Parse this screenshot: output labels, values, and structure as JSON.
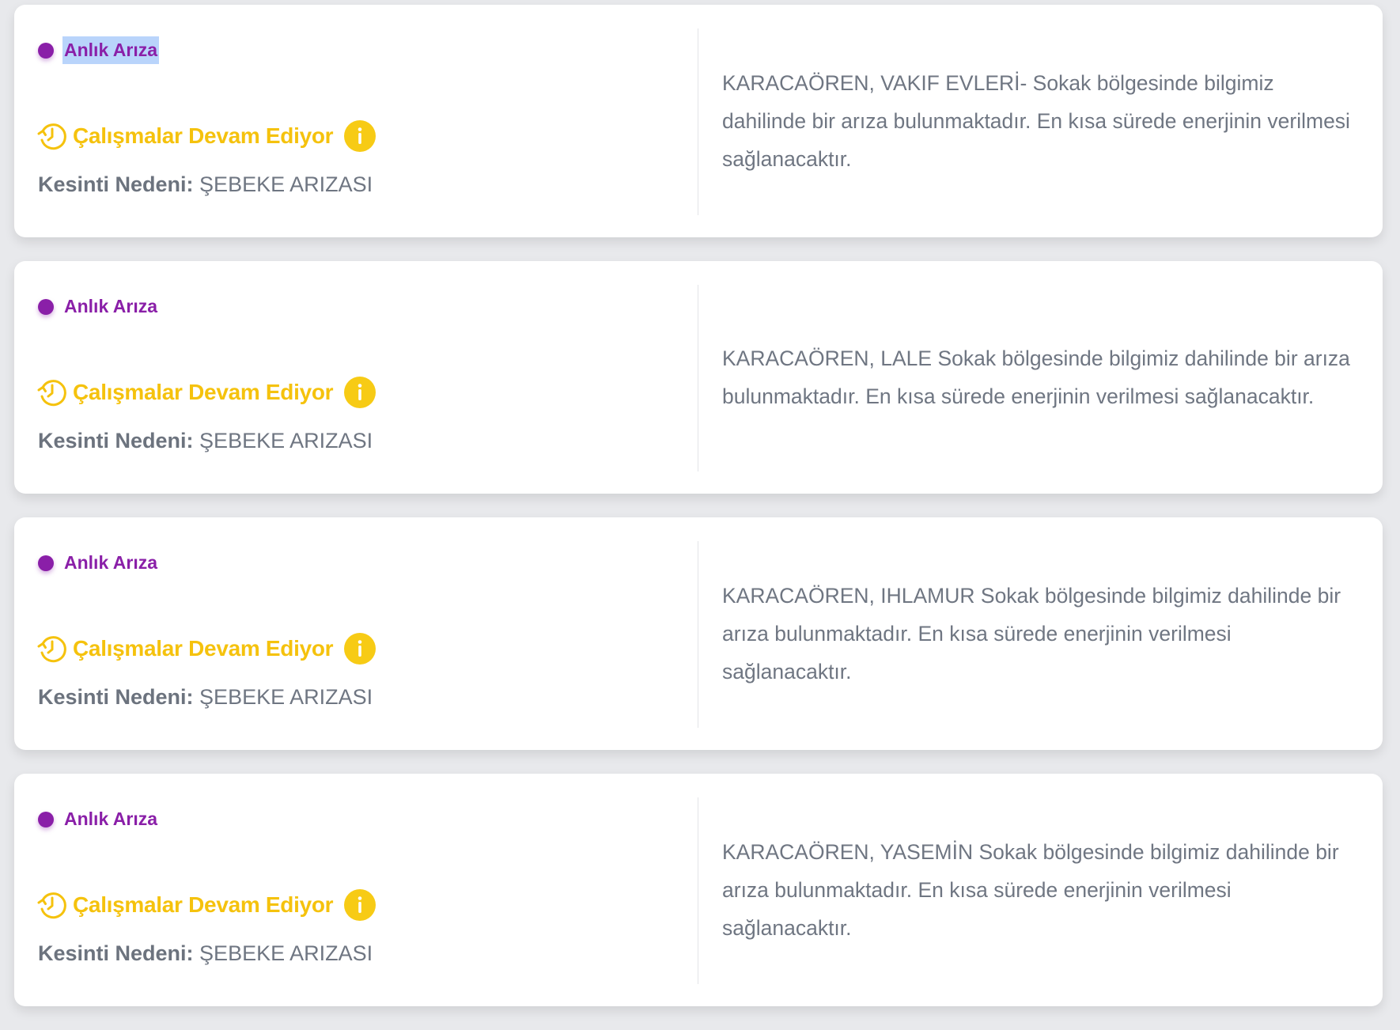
{
  "colors": {
    "type_accent": "#8a1fa8",
    "status_accent": "#f5c20d",
    "text": "#6f7682",
    "background": "#e8e9ec"
  },
  "icons": {
    "status": "clock-progress-icon",
    "info": "info-icon"
  },
  "cards": [
    {
      "type": "Anlık Arıza",
      "status": "Çalışmalar Devam Ediyor",
      "reason_label": "Kesinti Nedeni:",
      "reason_value": "ŞEBEKE ARIZASI",
      "description": "KARACAÖREN, VAKIF EVLERİ- Sokak bölgesinde bilgimiz dahilinde bir arıza bulunmaktadır. En kısa sürede enerjinin verilmesi sağlanacaktır."
    },
    {
      "type": "Anlık Arıza",
      "status": "Çalışmalar Devam Ediyor",
      "reason_label": "Kesinti Nedeni:",
      "reason_value": "ŞEBEKE ARIZASI",
      "description": "KARACAÖREN, LALE Sokak bölgesinde bilgimiz dahilinde bir arıza bulunmaktadır. En kısa sürede enerjinin verilmesi sağlanacaktır."
    },
    {
      "type": "Anlık Arıza",
      "status": "Çalışmalar Devam Ediyor",
      "reason_label": "Kesinti Nedeni:",
      "reason_value": "ŞEBEKE ARIZASI",
      "description": "KARACAÖREN, IHLAMUR Sokak bölgesinde bilgimiz dahilinde bir arıza bulunmaktadır. En kısa sürede enerjinin verilmesi sağlanacaktır."
    },
    {
      "type": "Anlık Arıza",
      "status": "Çalışmalar Devam Ediyor",
      "reason_label": "Kesinti Nedeni:",
      "reason_value": "ŞEBEKE ARIZASI",
      "description": "KARACAÖREN, YASEMİN Sokak bölgesinde bilgimiz dahilinde bir arıza bulunmaktadır. En kısa sürede enerjinin verilmesi sağlanacaktır."
    }
  ]
}
